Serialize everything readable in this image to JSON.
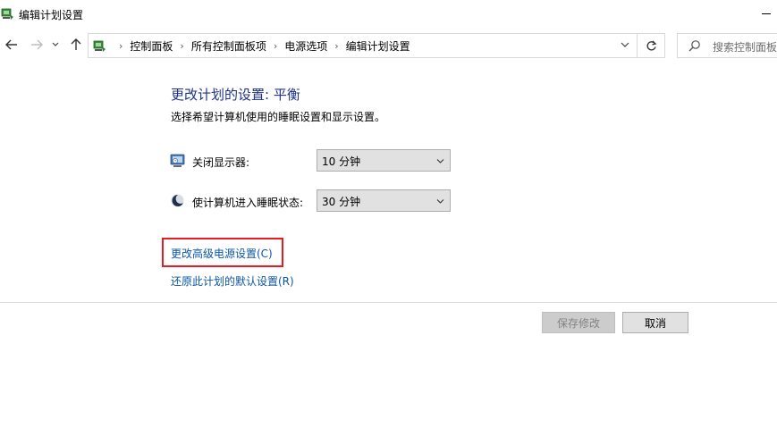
{
  "window": {
    "title": "编辑计划设置",
    "app_icon": "power-options-icon"
  },
  "nav": {
    "back_icon": "back-arrow-icon",
    "forward_icon": "forward-arrow-icon",
    "recent_icon": "chevron-down-icon",
    "up_icon": "up-arrow-icon",
    "refresh_icon": "refresh-icon",
    "breadcrumbs": [
      "控制面板",
      "所有控制面板项",
      "电源选项",
      "编辑计划设置"
    ],
    "search_placeholder": "搜索控制面板"
  },
  "main": {
    "heading": "更改计划的设置: 平衡",
    "subheading": "选择希望计算机使用的睡眠设置和显示设置。",
    "settings": [
      {
        "label": "关闭显示器:",
        "icon": "display-icon",
        "value": "10 分钟"
      },
      {
        "label": "使计算机进入睡眠状态:",
        "icon": "sleep-moon-icon",
        "value": "30 分钟"
      }
    ],
    "links": {
      "advanced": "更改高级电源设置(C)",
      "restore": "还原此计划的默认设置(R)"
    },
    "buttons": {
      "save": "保存修改",
      "cancel": "取消"
    }
  },
  "colors": {
    "heading": "#1e3287",
    "link": "#0b57a4",
    "highlight": "#e81b23"
  }
}
